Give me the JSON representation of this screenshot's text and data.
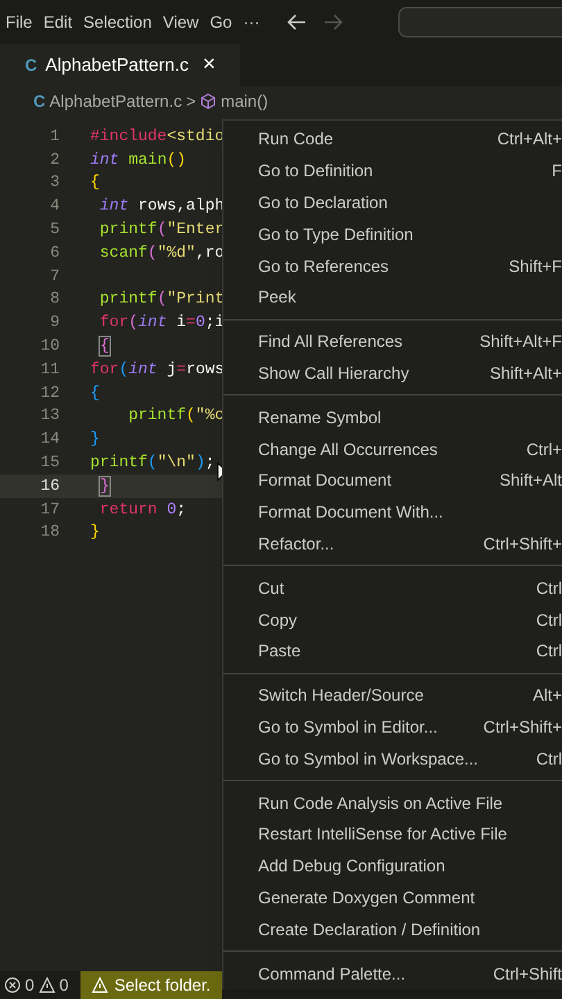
{
  "menu_bar": {
    "items": [
      "File",
      "Edit",
      "Selection",
      "View",
      "Go",
      "···"
    ]
  },
  "nav": {
    "back_disabled": false,
    "forward_disabled": true
  },
  "tab": {
    "file_icon": "C",
    "label": "AlphabetPattern.c",
    "close": "×"
  },
  "breadcrumb": {
    "file_icon": "C",
    "file": "AlphabetPattern.c",
    "separator": ">",
    "symbol": "main()"
  },
  "code_lines": [
    {
      "number": "1",
      "current": false,
      "tokens": [
        {
          "text": "#include",
          "kind": "kw"
        },
        {
          "text": "<stdio",
          "kind": "str"
        }
      ]
    },
    {
      "number": "2",
      "current": false,
      "tokens": [
        {
          "text": "int",
          "kind": "type"
        },
        {
          "text": " main",
          "kind": "fn"
        },
        {
          "text": "()",
          "kind": "br1"
        }
      ]
    },
    {
      "number": "3",
      "current": false,
      "tokens": [
        {
          "text": "{",
          "kind": "br1"
        }
      ]
    },
    {
      "number": "4",
      "current": false,
      "tokens": [
        {
          "text": " int",
          "kind": "type"
        },
        {
          "text": " rows,alph",
          "kind": "plain"
        }
      ]
    },
    {
      "number": "5",
      "current": false,
      "tokens": [
        {
          "text": " printf",
          "kind": "fn"
        },
        {
          "text": "(",
          "kind": "br2"
        },
        {
          "text": "\"Enter",
          "kind": "str"
        }
      ]
    },
    {
      "number": "6",
      "current": false,
      "tokens": [
        {
          "text": " scanf",
          "kind": "fn"
        },
        {
          "text": "(",
          "kind": "br2"
        },
        {
          "text": "\"%d\"",
          "kind": "str"
        },
        {
          "text": ",ro",
          "kind": "plain"
        }
      ]
    },
    {
      "number": "7",
      "current": false
    },
    {
      "number": "8",
      "current": false,
      "tokens": [
        {
          "text": " printf",
          "kind": "fn"
        },
        {
          "text": "(",
          "kind": "br2"
        },
        {
          "text": "\"Print",
          "kind": "str"
        }
      ]
    },
    {
      "number": "9",
      "current": false,
      "tokens": [
        {
          "text": " for",
          "kind": "kw"
        },
        {
          "text": "(",
          "kind": "br2"
        },
        {
          "text": "int",
          "kind": "type"
        },
        {
          "text": " i",
          "kind": "plain"
        },
        {
          "text": "=",
          "kind": "kw"
        },
        {
          "text": "0",
          "kind": "num"
        },
        {
          "text": ";i",
          "kind": "plain"
        }
      ]
    },
    {
      "number": "10",
      "current": false,
      "tokens": [
        {
          "text": "{",
          "kind": "br2",
          "matched": true
        }
      ]
    },
    {
      "number": "11",
      "current": false,
      "tokens": [
        {
          "text": "for",
          "kind": "kw"
        },
        {
          "text": "(",
          "kind": "br3"
        },
        {
          "text": "int",
          "kind": "type"
        },
        {
          "text": " j",
          "kind": "plain"
        },
        {
          "text": "=",
          "kind": "kw"
        },
        {
          "text": "rows",
          "kind": "plain"
        }
      ]
    },
    {
      "number": "12",
      "current": false,
      "tokens": [
        {
          "text": "{",
          "kind": "br3"
        }
      ]
    },
    {
      "number": "13",
      "current": false,
      "tokens": [
        {
          "text": "    printf",
          "kind": "fn"
        },
        {
          "text": "(",
          "kind": "br1"
        },
        {
          "text": "\"%c",
          "kind": "str"
        }
      ]
    },
    {
      "number": "14",
      "current": false,
      "tokens": [
        {
          "text": "}",
          "kind": "br3"
        }
      ]
    },
    {
      "number": "15",
      "current": false,
      "tokens": [
        {
          "text": "printf",
          "kind": "fn"
        },
        {
          "text": "(",
          "kind": "br3"
        },
        {
          "text": "\"\\n\"",
          "kind": "str"
        },
        {
          "text": ")",
          "kind": "br3"
        },
        {
          "text": ";",
          "kind": "plain"
        }
      ]
    },
    {
      "number": "16",
      "current": true,
      "tokens": [
        {
          "text": "}",
          "kind": "br2",
          "matched": true
        }
      ]
    },
    {
      "number": "17",
      "current": false,
      "tokens": [
        {
          "text": " return",
          "kind": "kw"
        },
        {
          "text": " 0",
          "kind": "num"
        },
        {
          "text": ";",
          "kind": "plain"
        }
      ]
    },
    {
      "number": "18",
      "current": false,
      "tokens": [
        {
          "text": "}",
          "kind": "br1"
        }
      ]
    }
  ],
  "context_menu": {
    "groups": [
      [
        {
          "label": "Run Code",
          "shortcut": "Ctrl+Alt+"
        },
        {
          "label": "Go to Definition",
          "shortcut": "F"
        },
        {
          "label": "Go to Declaration"
        },
        {
          "label": "Go to Type Definition"
        },
        {
          "label": "Go to References",
          "shortcut": "Shift+F"
        },
        {
          "label": "Peek"
        }
      ],
      [
        {
          "label": "Find All References",
          "shortcut": "Shift+Alt+F"
        },
        {
          "label": "Show Call Hierarchy",
          "shortcut": "Shift+Alt+"
        }
      ],
      [
        {
          "label": "Rename Symbol"
        },
        {
          "label": "Change All Occurrences",
          "shortcut": "Ctrl+"
        },
        {
          "label": "Format Document",
          "shortcut": "Shift+Alt"
        },
        {
          "label": "Format Document With..."
        },
        {
          "label": "Refactor...",
          "shortcut": "Ctrl+Shift+"
        }
      ],
      [
        {
          "label": "Cut",
          "shortcut": "Ctrl"
        },
        {
          "label": "Copy",
          "shortcut": "Ctrl"
        },
        {
          "label": "Paste",
          "shortcut": "Ctrl"
        }
      ],
      [
        {
          "label": "Switch Header/Source",
          "shortcut": "Alt+"
        },
        {
          "label": "Go to Symbol in Editor...",
          "shortcut": "Ctrl+Shift+"
        },
        {
          "label": "Go to Symbol in Workspace...",
          "shortcut": "Ctrl"
        }
      ],
      [
        {
          "label": "Run Code Analysis on Active File"
        },
        {
          "label": "Restart IntelliSense for Active File"
        },
        {
          "label": "Add Debug Configuration"
        },
        {
          "label": "Generate Doxygen Comment"
        },
        {
          "label": "Create Declaration / Definition"
        }
      ],
      [
        {
          "label": "Command Palette...",
          "shortcut": "Ctrl+Shift"
        }
      ]
    ]
  },
  "status_bar": {
    "errors": "0",
    "warnings": "0",
    "folder_notice": "Select folder."
  }
}
